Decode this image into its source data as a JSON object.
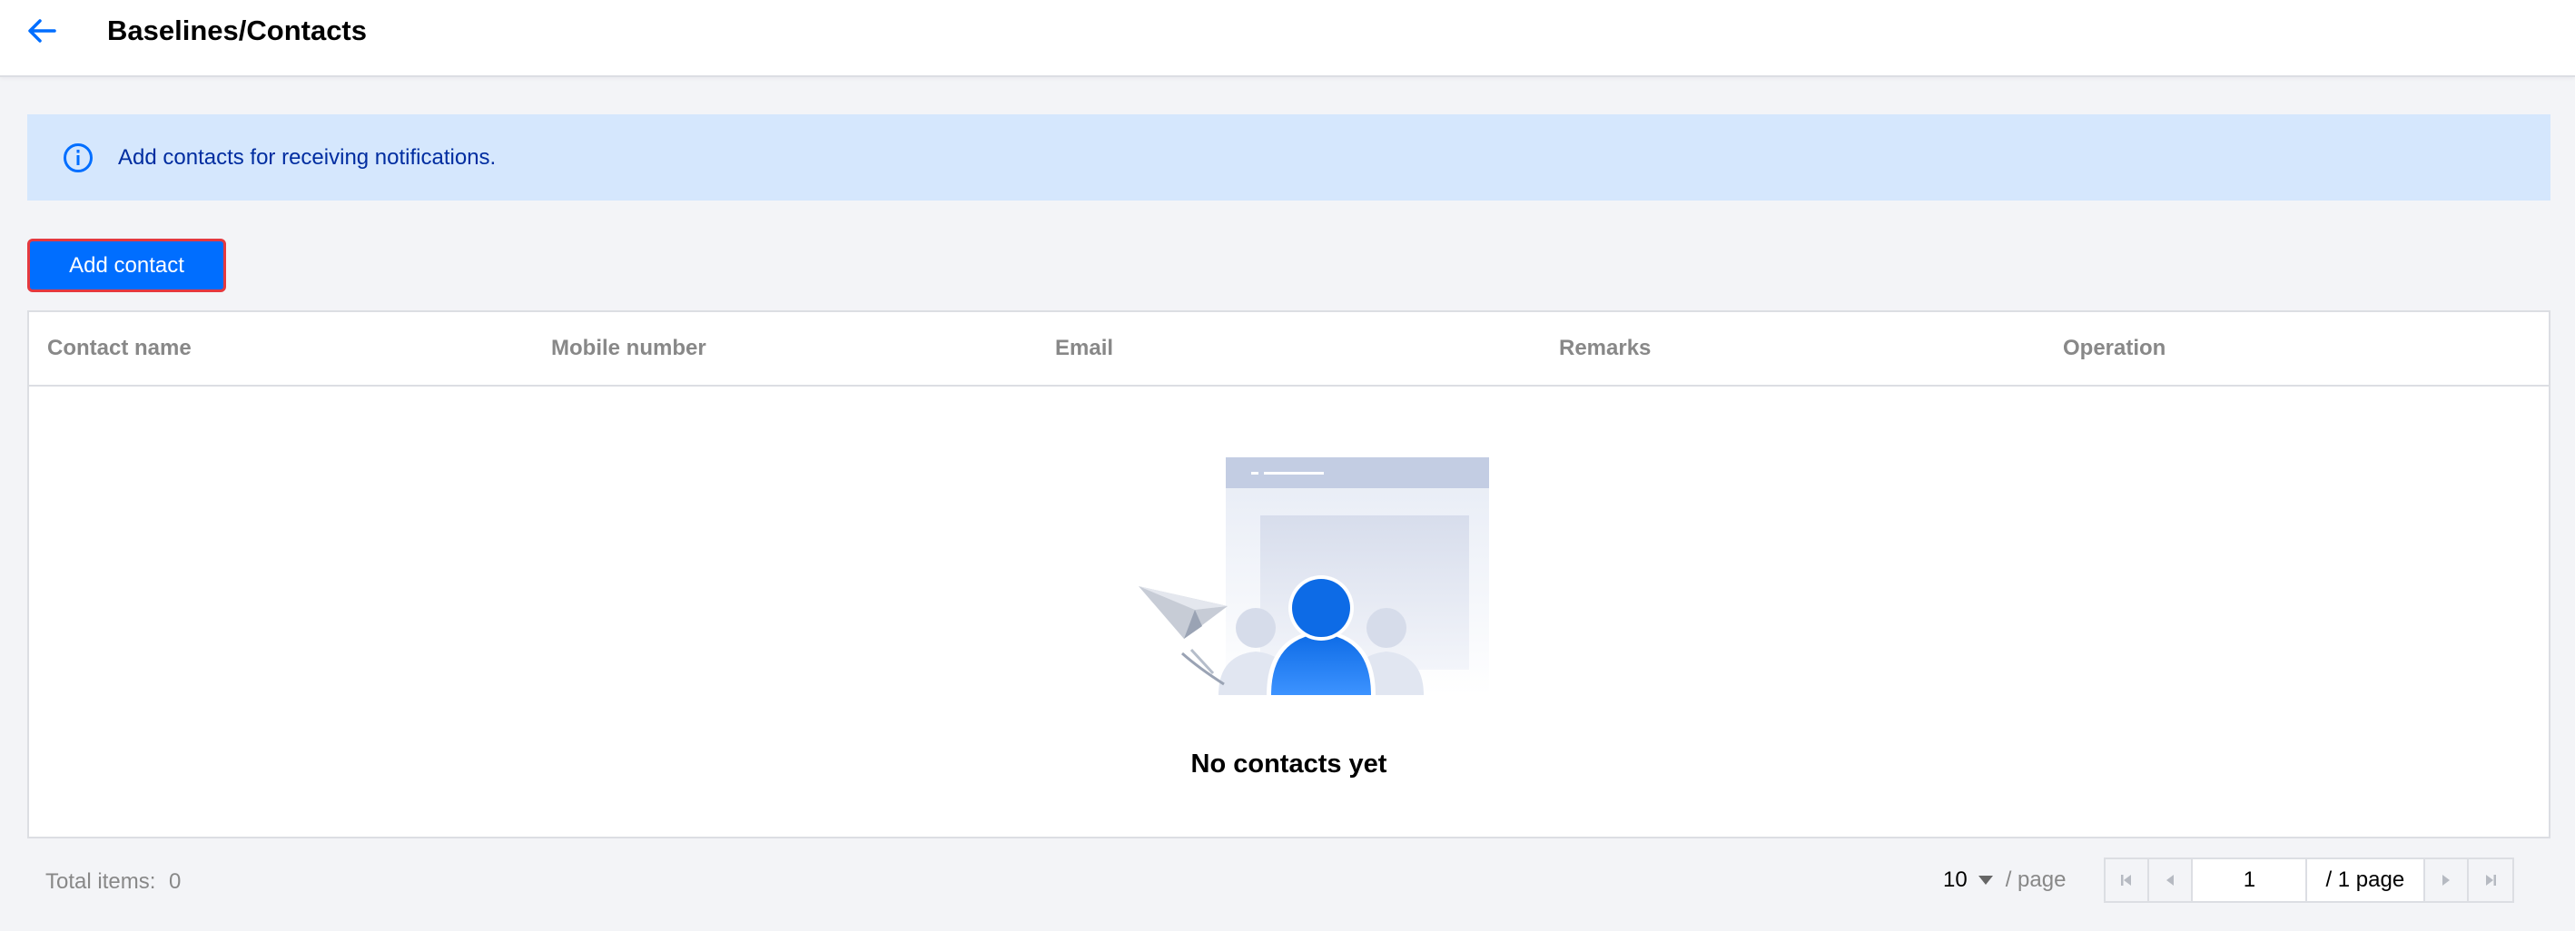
{
  "header": {
    "title": "Baselines/Contacts"
  },
  "notice": {
    "text": "Add contacts for receiving notifications."
  },
  "toolbar": {
    "add_label": "Add contact"
  },
  "table": {
    "columns": [
      "Contact name",
      "Mobile number",
      "Email",
      "Remarks",
      "Operation"
    ],
    "empty_text": "No contacts yet"
  },
  "footer": {
    "total_label": "Total items:",
    "total_value": "0",
    "page_size": "10",
    "per_page_label": "/ page",
    "current_page": "1",
    "total_pages_label": "/ 1 page"
  },
  "colors": {
    "accent": "#006eff",
    "notice_bg": "#d5e7fd",
    "highlight_border": "#e5393f"
  }
}
